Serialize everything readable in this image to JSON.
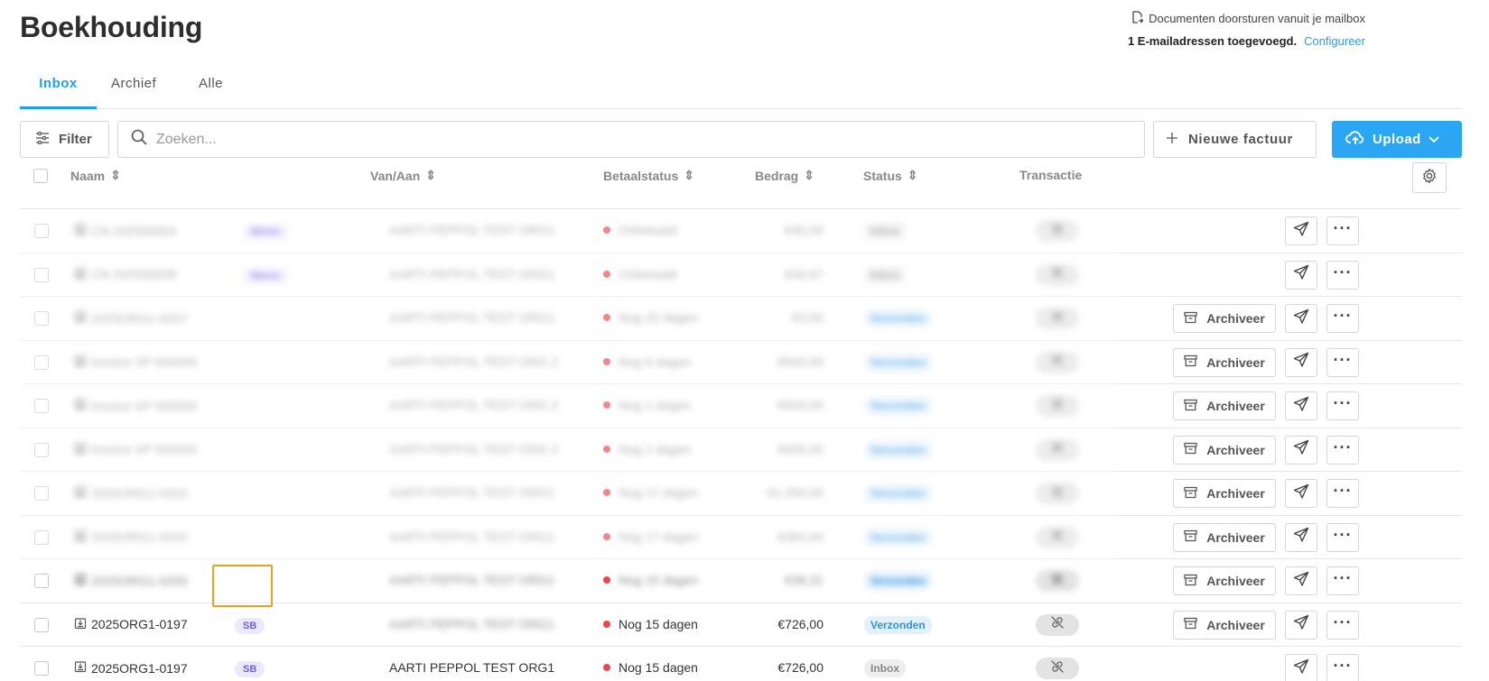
{
  "page": {
    "title": "Boekhouding"
  },
  "mailbox": {
    "forward_text": "Documenten doorsturen vanuit je mailbox",
    "count_text": "1 E-mailadressen toegevoegd.",
    "configure_label": "Configureer"
  },
  "tabs": [
    {
      "label": "Inbox",
      "active": true
    },
    {
      "label": "Archief",
      "active": false
    },
    {
      "label": "Alle",
      "active": false
    }
  ],
  "toolbar": {
    "filter_label": "Filter",
    "search_placeholder": "Zoeken...",
    "new_invoice_label": "Nieuwe factuur",
    "upload_label": "Upload"
  },
  "table": {
    "columns": {
      "name": "Naam",
      "from_to": "Van/Aan",
      "payment_status": "Betaalstatus",
      "amount": "Bedrag",
      "status": "Status",
      "transaction": "Transactie"
    },
    "archive_label": "Archiveer",
    "rows": [
      {
        "name": "CN 202500004",
        "tag": "Memo",
        "party": "AARTI PEPPOL TEST ORG1",
        "payment": "Onbetaald",
        "amount": "€40,00",
        "status": "Inbox",
        "blurred": true
      },
      {
        "name": "CN 202500008",
        "tag": "Memo",
        "party": "AARTI PEPPOL TEST ORG1",
        "payment": "Onbetaald",
        "amount": "€40,67",
        "status": "Inbox",
        "blurred": true
      },
      {
        "name": "2025ORG1-0207",
        "tag": "",
        "party": "AARTI PEPPOL TEST ORG1",
        "payment": "Nog 25 dagen",
        "amount": "€3,00",
        "status": "Verzonden",
        "blurred": true
      },
      {
        "name": "Invoice XP 000000",
        "tag": "",
        "party": "AARTI PEPPOL TEST ORG 2",
        "payment": "Nog 6 dagen",
        "amount": "€500,00",
        "status": "Verzonden",
        "blurred": true
      },
      {
        "name": "Invoice XP 000000",
        "tag": "",
        "party": "AARTI PEPPOL TEST ORG 2",
        "payment": "Nog 1 dagen",
        "amount": "€500,00",
        "status": "Verzonden",
        "blurred": true
      },
      {
        "name": "Invoice XP 000003",
        "tag": "",
        "party": "AARTI PEPPOL TEST ORG 2",
        "payment": "Nog 1 dagen",
        "amount": "€600,00",
        "status": "Verzonden",
        "blurred": true
      },
      {
        "name": "2025ORG1-0202",
        "tag": "",
        "party": "AARTI PEPPOL TEST ORG1",
        "payment": "Nog 17 dagen",
        "amount": "€1.250,00",
        "status": "Verzonden",
        "blurred": true
      },
      {
        "name": "2025ORG1-0202",
        "tag": "",
        "party": "AARTI PEPPOL TEST ORG1",
        "payment": "Nog 17 dagen",
        "amount": "€360,00",
        "status": "Verzonden",
        "blurred": true
      },
      {
        "name": "2025ORG1-0200",
        "tag": "",
        "party": "AARTI PEPPOL TEST ORG1",
        "payment": "Nog 15 dagen",
        "amount": "€36,31",
        "status": "Verzonden",
        "blurred": true
      },
      {
        "name": "2025ORG1-0197",
        "tag": "SB",
        "party": "AARTI PEPPOL TEST ORG1",
        "payment": "Nog 15 dagen",
        "amount": "€726,00",
        "status": "Verzonden",
        "blurred": false,
        "party_blurred": true
      },
      {
        "name": "2025ORG1-0197",
        "tag": "SB",
        "party": "AARTI PEPPOL TEST ORG1",
        "payment": "Nog 15 dagen",
        "amount": "€726,00",
        "status": "Inbox",
        "blurred": false,
        "party_blurred": false
      }
    ]
  },
  "colors": {
    "accent": "#1ea0f0",
    "upload_bg": "#2aa6f2",
    "unpaid_dot": "#f0454d",
    "highlight": "#e8a21c"
  }
}
